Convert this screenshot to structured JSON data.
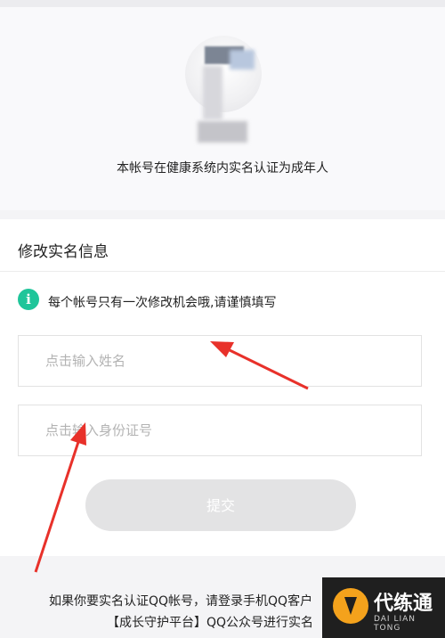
{
  "header": {
    "verify_text": "本帐号在健康系统内实名认证为成年人"
  },
  "form": {
    "title": "修改实名信息",
    "notice": "每个帐号只有一次修改机会哦,请谨慎填写",
    "info_icon": "i",
    "name_placeholder": "点击输入姓名",
    "id_placeholder": "点击输入身份证号",
    "submit_label": "提交"
  },
  "footer": {
    "line1": "如果你要实名认证QQ帐号，请登录手机QQ客户",
    "line2": "【成长守护平台】QQ公众号进行实名"
  },
  "watermark": {
    "title": "代练通",
    "subtitle": "DAI LIAN TONG"
  },
  "colors": {
    "accent_green": "#1fc59a",
    "arrow_red": "#e8312a",
    "submit_disabled": "#e3e3e4"
  }
}
